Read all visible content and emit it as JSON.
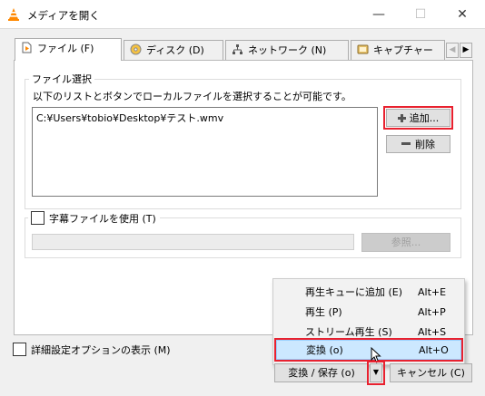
{
  "window": {
    "title": "メディアを開く"
  },
  "tabs": [
    {
      "label": "ファイル (F)",
      "icon": "file-icon"
    },
    {
      "label": "ディスク (D)",
      "icon": "disc-icon"
    },
    {
      "label": "ネットワーク (N)",
      "icon": "network-icon"
    },
    {
      "label": "キャプチャー",
      "icon": "capture-icon"
    }
  ],
  "file_section": {
    "legend": "ファイル選択",
    "description": "以下のリストとボタンでローカルファイルを選択することが可能です。",
    "files": [
      "C:¥Users¥tobio¥Desktop¥テスト.wmv"
    ],
    "add_label": "追加...",
    "remove_label": "削除"
  },
  "subtitle_section": {
    "checkbox_label": "字幕ファイルを使用 (T)",
    "browse_label": "参照..."
  },
  "advanced_label": "詳細設定オプションの表示 (M)",
  "menu": {
    "items": [
      {
        "label": "再生キューに追加 (E)",
        "shortcut": "Alt+E"
      },
      {
        "label": "再生 (P)",
        "shortcut": "Alt+P"
      },
      {
        "label": "ストリーム再生 (S)",
        "shortcut": "Alt+S"
      },
      {
        "label": "変換 (o)",
        "shortcut": "Alt+O"
      }
    ]
  },
  "footer": {
    "convert_label": "変換 / 保存 (o)",
    "cancel_label": "キャンセル (C)"
  },
  "colors": {
    "highlight_red": "#e8212f",
    "vlc_orange": "#ff8800",
    "menu_selected": "#cce8ff"
  }
}
